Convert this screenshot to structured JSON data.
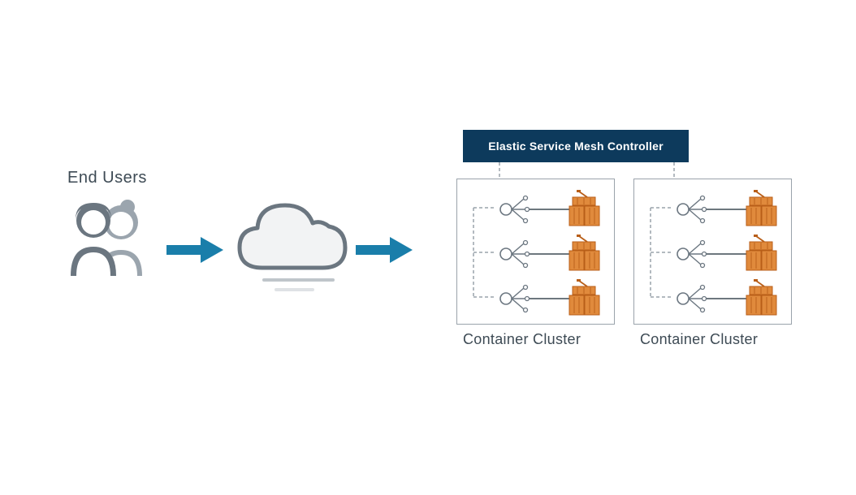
{
  "labels": {
    "endUsers": "End Users",
    "meshController": "Elastic Service Mesh Controller",
    "cluster1": "Container Cluster",
    "cluster2": "Container Cluster"
  },
  "colors": {
    "arrow": "#1a7eaa",
    "darkBox": "#0d3a5c",
    "text": "#3d4a54",
    "border": "#9aa3ab",
    "container": "#d97a2b",
    "containerDark": "#b85e18"
  },
  "architecture": {
    "flow": [
      "end-users",
      "cloud",
      "clusters"
    ],
    "clusters": 2,
    "servicesPerCluster": 3
  }
}
